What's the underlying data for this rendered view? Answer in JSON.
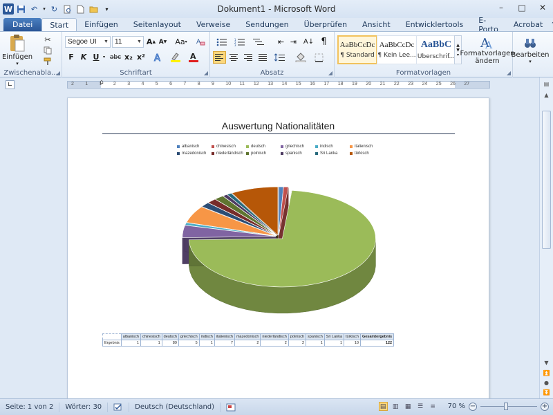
{
  "window": {
    "title": "Dokument1 - Microsoft Word",
    "minimize": "–",
    "maximize": "□",
    "close": "✕"
  },
  "qat": {
    "logo": "W"
  },
  "tabs": [
    "Datei",
    "Start",
    "Einfügen",
    "Seitenlayout",
    "Verweise",
    "Sendungen",
    "Überprüfen",
    "Ansicht",
    "Entwicklertools",
    "E-Porto",
    "Acrobat"
  ],
  "ribbon": {
    "clipboard": {
      "label": "Zwischenabla...",
      "paste": "Einfügen"
    },
    "font": {
      "label": "Schriftart",
      "family": "Segoe UI",
      "size": "11",
      "bold": "F",
      "italic": "K",
      "underline": "U",
      "strike": "abc",
      "sub": "x₂",
      "sup": "x²",
      "grow": "A",
      "shrink": "A",
      "case": "Aa"
    },
    "paragraph": {
      "label": "Absatz"
    },
    "styles": {
      "label": "Formatvorlagen",
      "items": [
        {
          "preview": "AaBbCcDc",
          "name": "¶ Standard"
        },
        {
          "preview": "AaBbCcDc",
          "name": "¶ Kein Lee..."
        },
        {
          "preview": "AaBbC",
          "name": "Überschrif..."
        }
      ],
      "change": "Formatvorlagen",
      "change2": "ändern"
    },
    "editing": {
      "label": "Bearbeiten"
    }
  },
  "ruler": {
    "numbers": [
      "2",
      "1",
      "1",
      "2",
      "3",
      "4",
      "5",
      "6",
      "7",
      "8",
      "9",
      "10",
      "11",
      "12",
      "13",
      "14",
      "15",
      "16",
      "17",
      "18",
      "19",
      "20",
      "21",
      "22",
      "23",
      "24",
      "25",
      "26",
      "27"
    ]
  },
  "document": {
    "title": "Auswertung Nationalitäten"
  },
  "chart_data": {
    "type": "pie",
    "title": "Auswertung Nationalitäten",
    "categories": [
      "albanisch",
      "chinesisch",
      "deutsch",
      "griechisch",
      "indisch",
      "italienisch",
      "mazedonisch",
      "niederländisch",
      "polnisch",
      "spanisch",
      "Sri Lanka",
      "türkisch"
    ],
    "values": [
      1,
      1,
      89,
      5,
      1,
      7,
      2,
      2,
      2,
      1,
      1,
      10
    ],
    "colors": [
      "#4f81bd",
      "#c0504d",
      "#9bbb59",
      "#8064a2",
      "#4bacc6",
      "#f79646",
      "#2c4d75",
      "#772c2a",
      "#5f7530",
      "#4d3b62",
      "#276a7c",
      "#b65708"
    ],
    "legend_position": "top",
    "total": 122
  },
  "table": {
    "row_label": "Ergebnis",
    "total_header": "Gesamtergebnis",
    "total": "122"
  },
  "statusbar": {
    "page": "Seite: 1 von 2",
    "words": "Wörter: 30",
    "language": "Deutsch (Deutschland)",
    "zoom": "70 %",
    "zoom_level": 0.45
  }
}
